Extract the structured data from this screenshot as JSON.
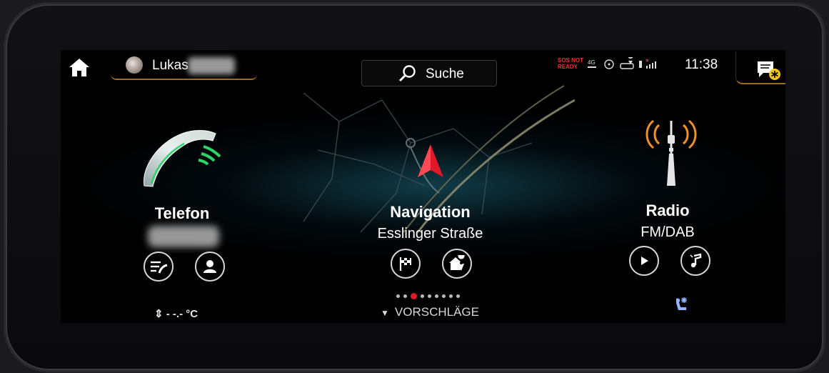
{
  "header": {
    "profile_name": "Lukas",
    "search_label": "Suche",
    "status_sos": "SOS NOT",
    "status_ready": "READY",
    "network": "4G",
    "time": "11:38"
  },
  "telefon": {
    "title": "Telefon",
    "temperature": "- -.- °C"
  },
  "navigation": {
    "title": "Navigation",
    "street": "Esslinger Straße",
    "suggestions_label": "VORSCHLÄGE",
    "page_count": 9,
    "active_page": 3
  },
  "radio": {
    "title": "Radio",
    "source": "FM/DAB"
  },
  "colors": {
    "accent_orange": "#a06a24",
    "nav_arrow_red": "#e0182a",
    "phone_green": "#2fd36a",
    "radio_wave_orange": "#f0902a"
  }
}
